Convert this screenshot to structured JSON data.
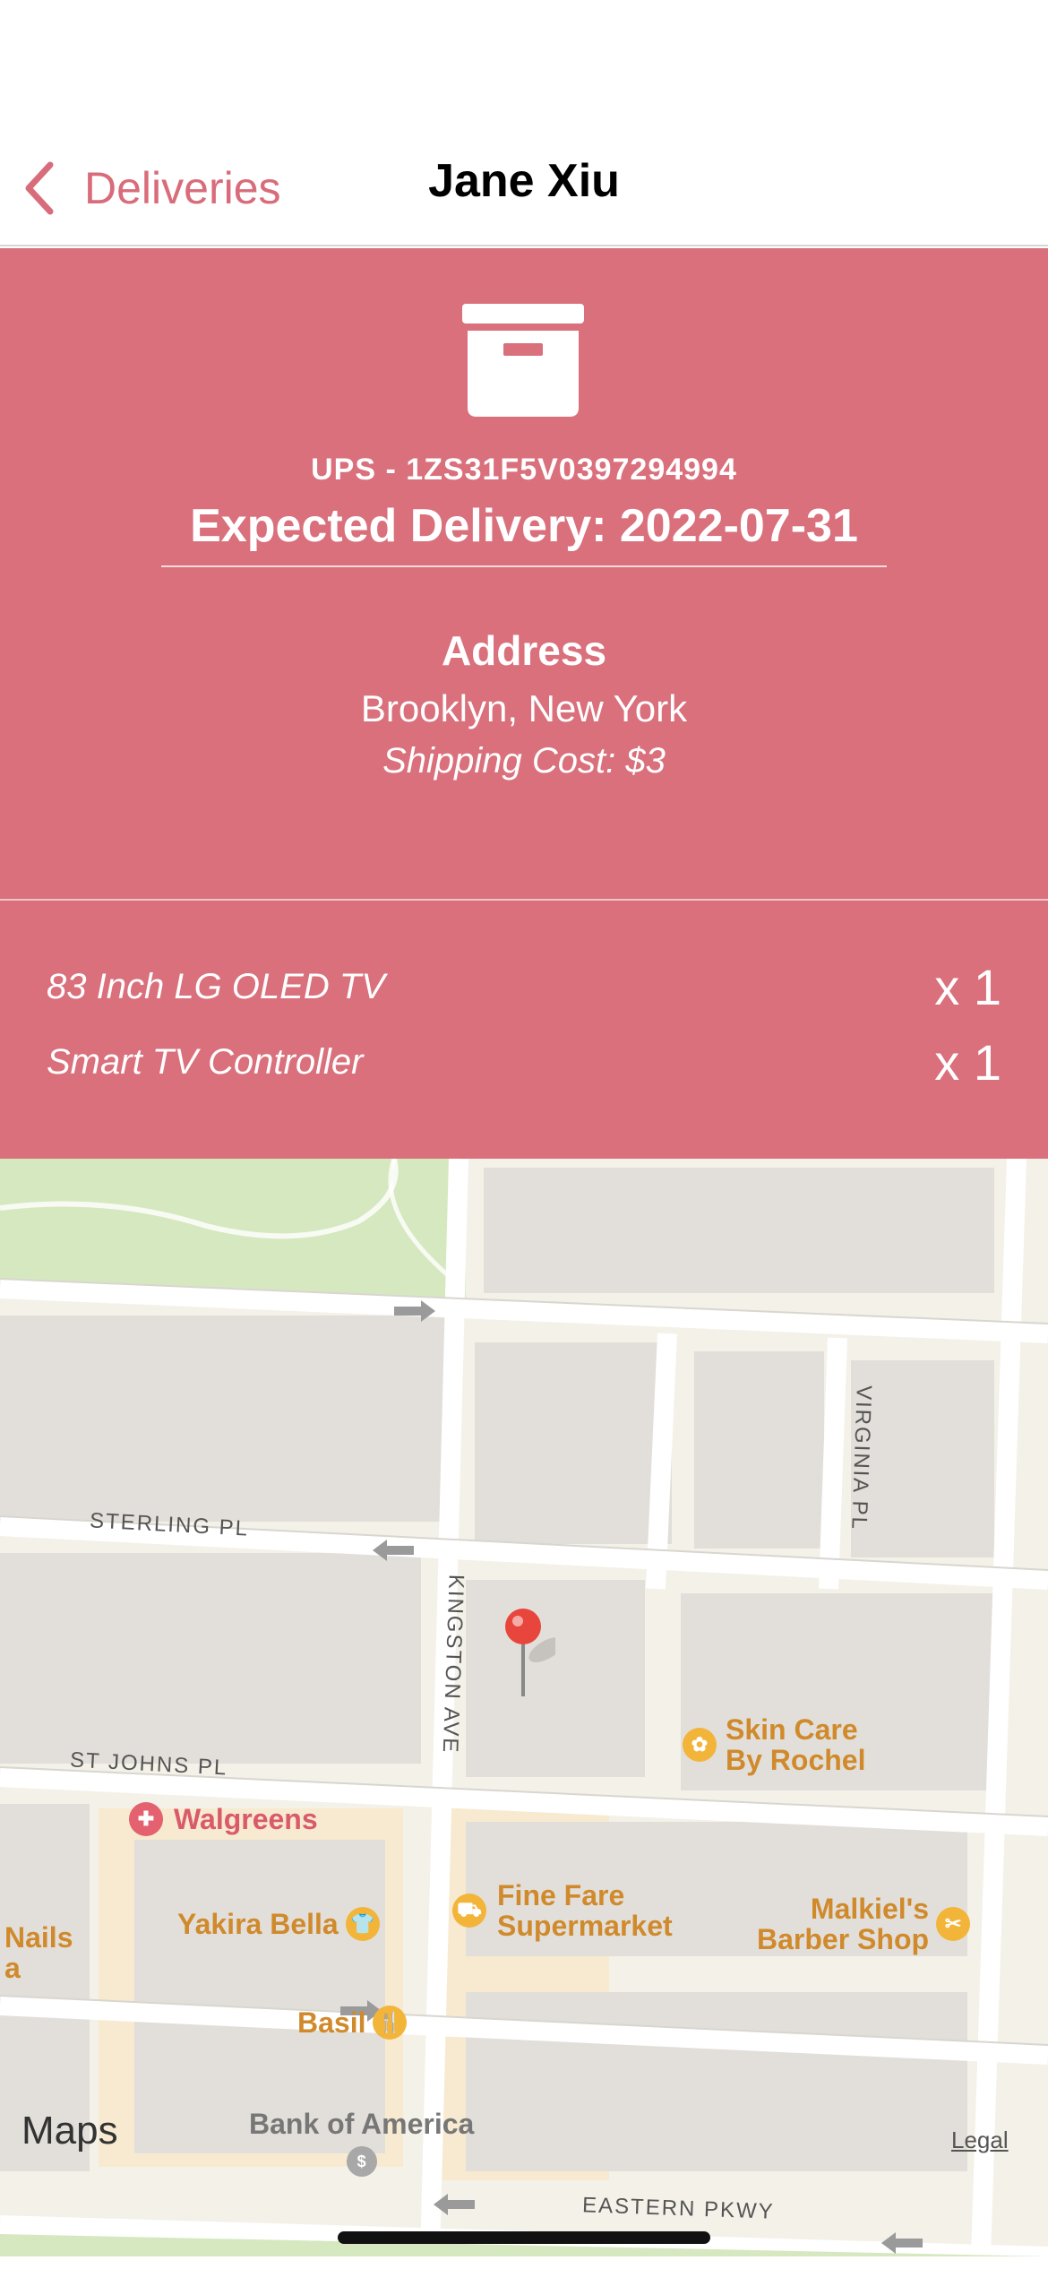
{
  "nav": {
    "back_label": "Deliveries",
    "title": "Jane Xiu"
  },
  "summary": {
    "icon": "archive-box-icon",
    "tracking": "UPS - 1ZS31F5V0397294994",
    "expected_delivery": "Expected Delivery: 2022-07-31",
    "address_heading": "Address",
    "address_value": "Brooklyn, New York",
    "shipping_cost": "Shipping Cost: $3"
  },
  "items": [
    {
      "name": "83 Inch LG OLED TV",
      "qty": "x 1"
    },
    {
      "name": "Smart TV Controller",
      "qty": "x 1"
    }
  ],
  "map": {
    "streets": {
      "sterling": "STERLING PL",
      "st_johns": "ST JOHNS PL",
      "kingston": "KINGSTON AVE",
      "virginia": "VIRGINIA PL",
      "eastern": "EASTERN PKWY"
    },
    "pois": {
      "skin_care": [
        "Skin Care",
        "By Rochel"
      ],
      "walgreens": "Walgreens",
      "fine_fare": [
        "Fine Fare",
        "Supermarket"
      ],
      "malkiels": [
        "Malkiel's",
        "Barber Shop"
      ],
      "nails": "Nails",
      "nails_sub": "a",
      "yakira": "Yakira Bella",
      "basil": "Basil",
      "bank": "Bank of America"
    },
    "logo": "Maps",
    "legal": "Legal"
  },
  "colors": {
    "accent": "#d9707c",
    "nav_tint": "#d96c7a"
  }
}
